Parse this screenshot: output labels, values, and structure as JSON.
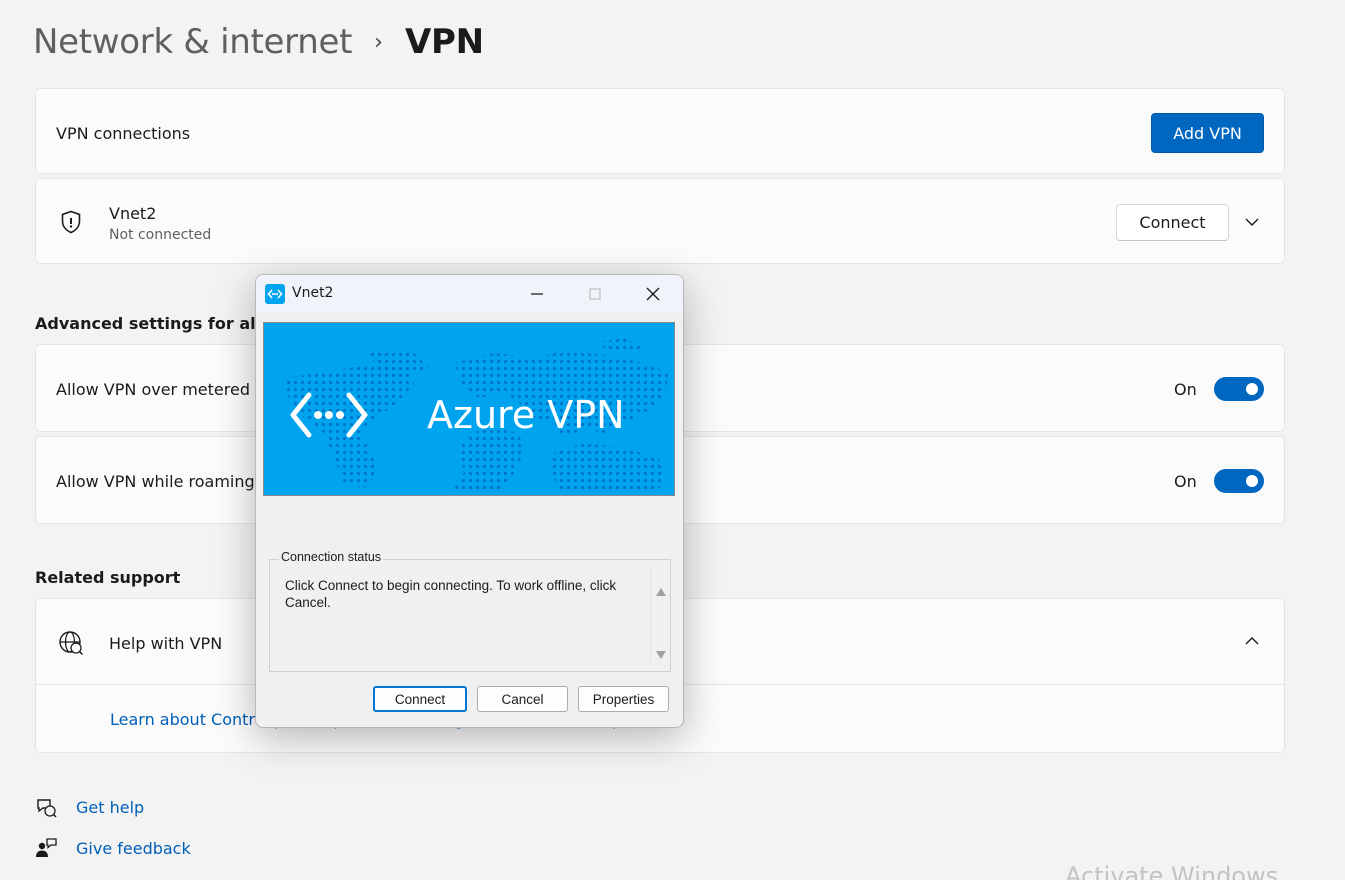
{
  "breadcrumb": {
    "parent": "Network & internet",
    "separator": "›",
    "current": "VPN"
  },
  "vpn_connections": {
    "label": "VPN connections",
    "add_button": "Add VPN"
  },
  "vpn_item": {
    "name": "Vnet2",
    "status": "Not connected",
    "connect_button": "Connect"
  },
  "advanced": {
    "title": "Advanced settings for all VPN connections",
    "rows": [
      {
        "label": "Allow VPN over metered networks",
        "state": "On"
      },
      {
        "label": "Allow VPN while roaming",
        "state": "On"
      }
    ]
  },
  "related": {
    "title": "Related support",
    "help_label": "Help with VPN",
    "link_label": "Learn about Control panel options in Settings and how to set up a VPN"
  },
  "footer": {
    "get_help": "Get help",
    "give_feedback": "Give feedback"
  },
  "dialog": {
    "title": "Vnet2",
    "banner_text": "Azure VPN",
    "group_label": "Connection status",
    "status_text": "Click Connect to begin connecting.  To work offline, click Cancel.",
    "connect_button": "Connect",
    "cancel_button": "Cancel",
    "properties_button": "Properties"
  },
  "watermark": "Activate Windows",
  "colors": {
    "accent": "#0067c0",
    "banner": "#00a3ee",
    "link": "#005fb8"
  },
  "icons": [
    "shield-icon",
    "chevron-down-icon",
    "chevron-up-icon",
    "globe-help-icon",
    "get-help-icon",
    "feedback-icon",
    "vpn-app-icon",
    "minimize-icon",
    "maximize-icon",
    "close-icon"
  ]
}
